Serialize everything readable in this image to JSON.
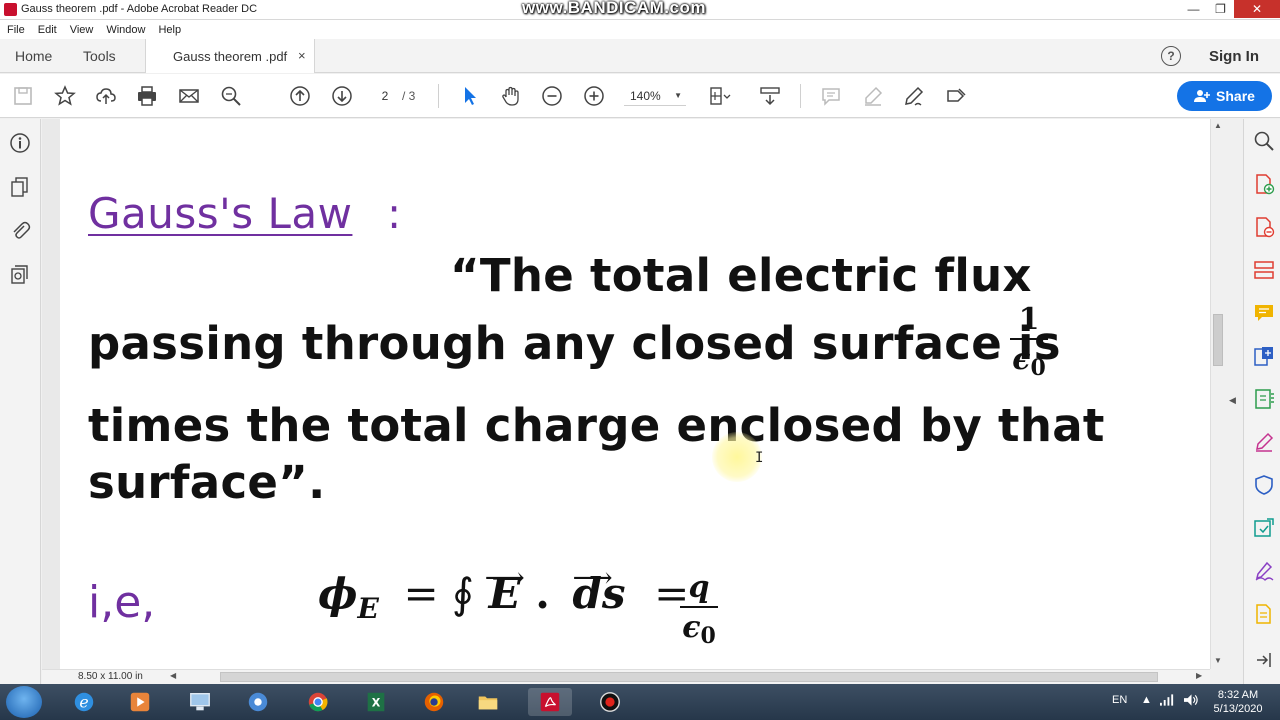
{
  "window": {
    "title": "Gauss theorem .pdf - Adobe Acrobat Reader DC",
    "watermark": "www.BANDICAM.com",
    "minimize": "—",
    "maximize": "❐",
    "close": "✕"
  },
  "menu": [
    "File",
    "Edit",
    "View",
    "Window",
    "Help"
  ],
  "tabs": {
    "home": "Home",
    "tools": "Tools",
    "document": "Gauss theorem .pdf",
    "close": "×",
    "help": "?",
    "signin": "Sign In"
  },
  "toolbar": {
    "page_current": "2",
    "page_total": "/  3",
    "zoom": "140%",
    "zoom_caret": "▼",
    "share": "Share"
  },
  "document": {
    "title": "Gauss's Law",
    "colon": ":",
    "line1": "“The total electric flux",
    "line2": "passing through any closed surface is",
    "line3": "times the total charge enclosed by that",
    "line4": "surface”.",
    "frac_num": "1",
    "frac_den": "ϵ",
    "frac_den_sub": "0",
    "ie": "i,e,",
    "eq_lhs": "ϕ",
    "eq_lhs_sub": "E",
    "eq_mid": "= ∮",
    "eq_E": "E",
    "eq_dot": ".",
    "eq_ds": "ds",
    "eq_eq": "=",
    "eq_num": "q",
    "eq_den": "ϵ",
    "eq_den_sub": "0"
  },
  "status": {
    "page_size": "8.50 x 11.00 in"
  },
  "taskbar": {
    "language": "EN",
    "time": "8:32 AM",
    "date": "5/13/2020"
  },
  "colors": {
    "accent": "#1473e6",
    "purple": "#7030a0",
    "close": "#c7312b"
  }
}
